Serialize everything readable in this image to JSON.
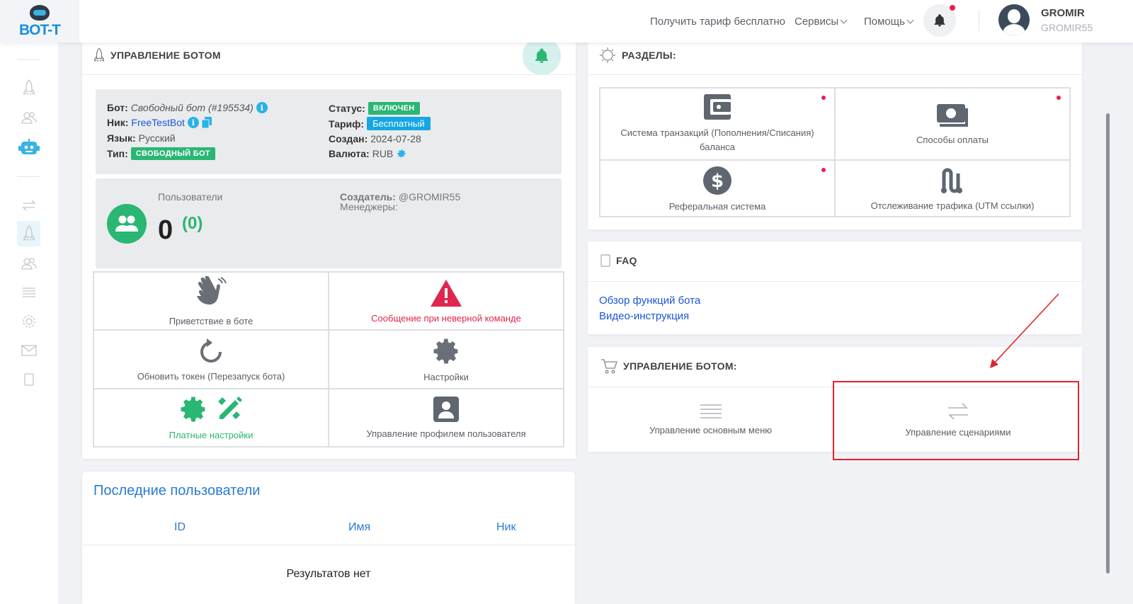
{
  "header": {
    "logo_text": "BOT-T",
    "nav": [
      {
        "label": "Получить тариф бесплатно"
      },
      {
        "label": "Сервисы"
      },
      {
        "label": "Помощь"
      }
    ],
    "user_name": "GROMIR",
    "user_login": "GROMIR55"
  },
  "bot_panel": {
    "title": "УПРАВЛЕНИЕ БОТОМ",
    "bot_label": "Бот:",
    "bot_value": "Свободный бот (#195534)",
    "nick_label": "Ник:",
    "nick_value": "FreeTestBot",
    "lang_label": "Язык:",
    "lang_value": "Русский",
    "type_label": "Тип:",
    "type_value": "СВОБОДНЫЙ БОТ",
    "status_label": "Статус:",
    "status_value": "ВКЛЮЧЕН",
    "tariff_label": "Тариф:",
    "tariff_value": "Бесплатный",
    "created_label": "Создан:",
    "created_value": "2024-07-28",
    "currency_label": "Валюта:",
    "currency_value": "RUB",
    "users_label": "Пользователи",
    "users_count": "0",
    "users_new": "(0)",
    "creator_label": "Создатель:",
    "creator_value": "@GROMIR55",
    "managers_label": "Менеджеры:",
    "tiles": {
      "greeting": "Приветствие в боте",
      "wrong_cmd": "Сообщение при неверной команде",
      "refresh_token": "Обновить токен (Перезапуск бота)",
      "settings": "Настройки",
      "paid_settings": "Платные настройки",
      "profile": "Управление профилем пользователя"
    }
  },
  "recent_users": {
    "title": "Последние пользователи",
    "columns": [
      "ID",
      "Имя",
      "Ник"
    ],
    "empty": "Результатов нет"
  },
  "sections": {
    "title": "РАЗДЕЛЫ:",
    "tiles": {
      "transactions": "Система транзакций (Пополнения/Списания) баланса",
      "payment_methods": "Способы оплаты",
      "referral": "Реферальная система",
      "utm": "Отслеживание трафика (UTM ссылки)"
    }
  },
  "faq": {
    "title": "FAQ",
    "links": [
      "Обзор функций бота",
      "Видео-инструкция"
    ]
  },
  "bot_manage": {
    "title": "УПРАВЛЕНИЕ БОТОМ:",
    "main_menu": "Управление основным меню",
    "scenarios": "Управление сценариями"
  },
  "colors": {
    "accent_green": "#2ab673",
    "accent_blue": "#15a6e3",
    "danger": "#e0254e",
    "annotation": "#e0242c"
  }
}
